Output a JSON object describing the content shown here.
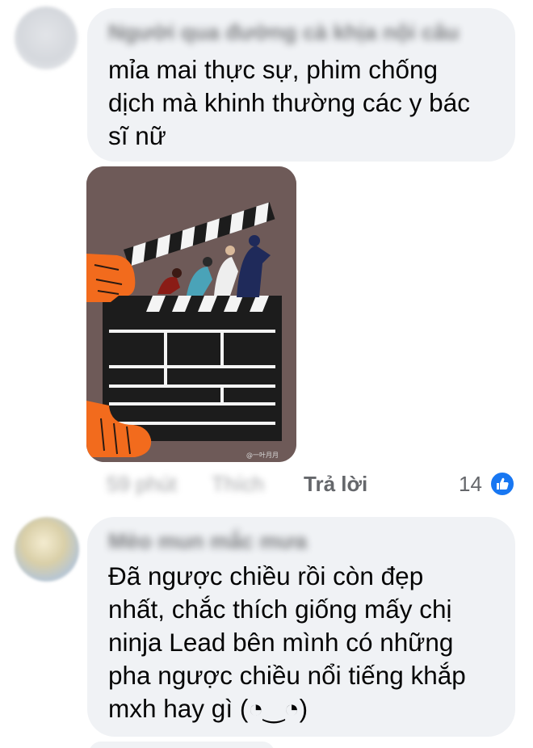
{
  "comments": [
    {
      "author": "Người qua đường cà khịa nội câu",
      "text": "mỉa mai thực sự, phim chống\ndịch mà khinh thường các y bác\nsĩ nữ",
      "image": {
        "watermark": "@一叶月月"
      },
      "meta": {
        "time": "59 phút",
        "like_label": "Thích",
        "reply_label": "Trả lời",
        "reaction_count": "14",
        "reaction_icon": "like-icon"
      }
    },
    {
      "author": "Mèo mun mắc mưa",
      "text": "Đã ngược chiều rồi còn đẹp\nnhất, chắc thích giống mấy chị\nninja Lead bên mình có những\npha ngược chiều nổi tiếng khắp\nmxh hay gì (◔‿◔)"
    }
  ],
  "colors": {
    "bubble": "#f0f2f5",
    "meta_text": "#65676b",
    "like_blue": "#1877f2",
    "image_bg": "#6e5a58",
    "hand_orange": "#f26b1d"
  }
}
